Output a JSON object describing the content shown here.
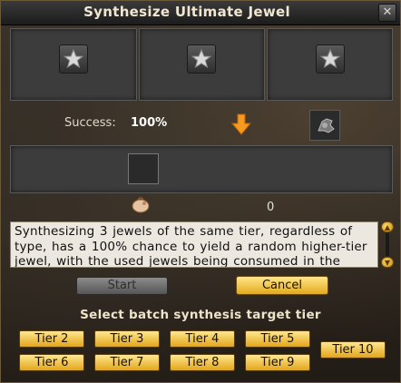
{
  "window": {
    "title": "Synthesize Ultimate Jewel",
    "close_glyph": "✕"
  },
  "slots": {
    "input_icons": [
      "star-jewel-icon",
      "star-jewel-icon",
      "star-jewel-icon"
    ],
    "result_icon": "result-slot-icon"
  },
  "status": {
    "success_label": "Success:",
    "success_value": "100%",
    "arrow_icon": "arrow-down-icon",
    "craft_icon": "synthesis-recipe-icon",
    "material_icon": "pouch-icon",
    "material_count": "0"
  },
  "description": "Synthesizing 3 jewels of the same tier, regardless of type, has a 100% chance to yield a random higher-tier jewel, with the used jewels being consumed in the process.",
  "buttons": {
    "start": "Start",
    "cancel": "Cancel"
  },
  "batch": {
    "label": "Select batch synthesis target tier",
    "tiers": [
      "Tier 2",
      "Tier 3",
      "Tier 4",
      "Tier 5",
      "Tier 6",
      "Tier 7",
      "Tier 8",
      "Tier 9",
      "Tier 10"
    ]
  },
  "colors": {
    "accent_gold": "#e3a91c",
    "arrow_orange": "#f59a1f",
    "text_light": "#f1e6cf"
  }
}
